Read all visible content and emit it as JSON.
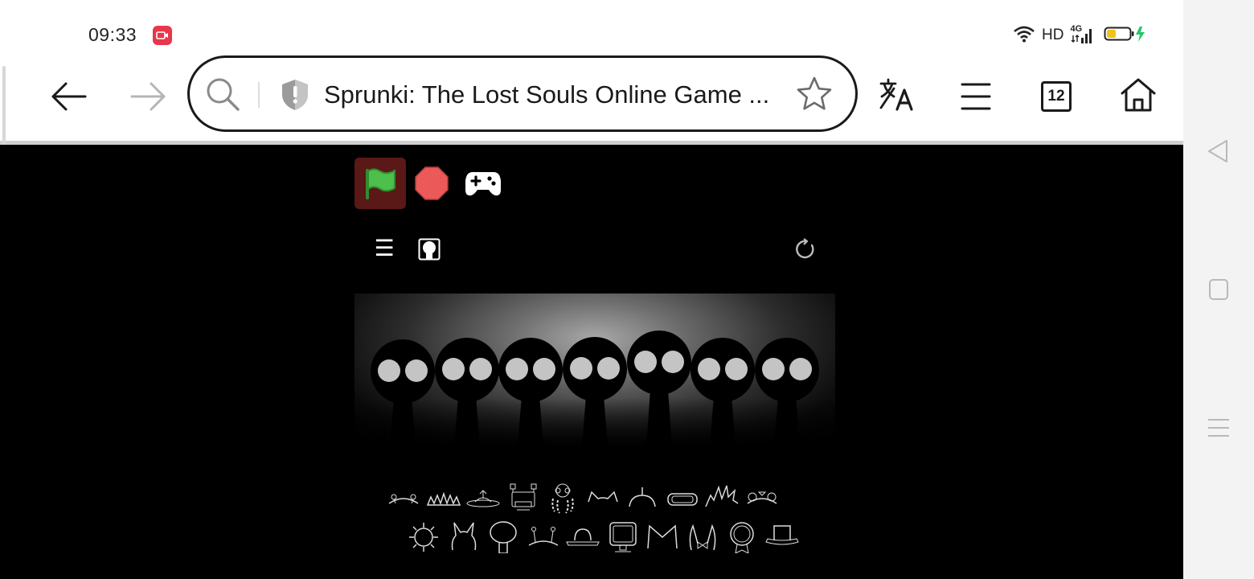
{
  "status_bar": {
    "time": "09:33",
    "network_label": "HD",
    "signal_label": "4G",
    "battery_level": 0.3,
    "charging": true,
    "recording_color": "#e8374a"
  },
  "browser": {
    "url_title": "Sprunki: The Lost Souls Online Game ...",
    "tab_count": "12",
    "icons": {
      "back": "arrow-left-icon",
      "forward": "arrow-right-icon",
      "search": "search-icon",
      "security": "shield-alert-icon",
      "bookmark": "star-icon",
      "translate": "translate-icon",
      "menu": "hamburger-icon",
      "tabs": "tabs-icon",
      "home": "home-icon"
    }
  },
  "game": {
    "controls": {
      "flag": "green-flag-icon",
      "stop": "stop-icon",
      "gamepad": "gamepad-icon",
      "menu_glyph": "☰",
      "avatar": "avatar-icon",
      "reload": "reload-icon"
    },
    "colors": {
      "flag_green": "#4cbf4c",
      "flag_bg": "#5a1816",
      "stop_red": "#ec5959",
      "background": "#000000"
    },
    "characters_count": 7,
    "sound_icons_row1": [
      "antennae-icon",
      "spikes-icon",
      "hat-disc-icon",
      "monitor-head-icon",
      "beads-icon",
      "cat-ears-icon",
      "horn-icon",
      "visor-icon",
      "spiky-hair-icon",
      "bow-ears-icon"
    ],
    "sound_icons_row2": [
      "sun-icon",
      "bunny-ears-icon",
      "tree-icon",
      "antenna-pair-icon",
      "bowler-hat-icon",
      "screen-icon",
      "crown-icon",
      "bowtie-ears-icon",
      "medal-icon",
      "top-hat-icon"
    ]
  },
  "nav_bar": {
    "icons": [
      "back-triangle-icon",
      "home-square-icon",
      "recents-lines-icon"
    ]
  }
}
